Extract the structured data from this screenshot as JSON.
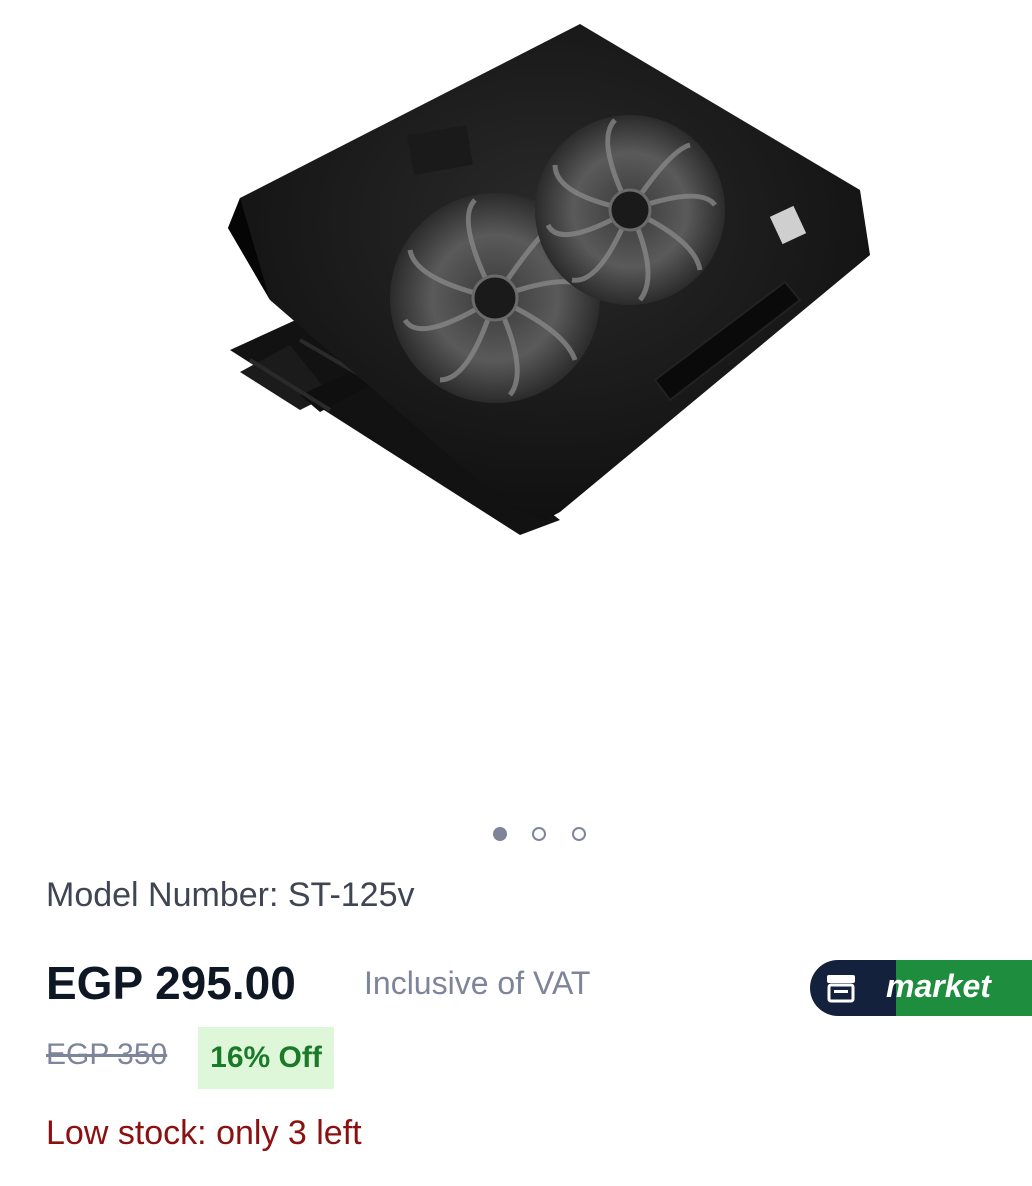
{
  "product": {
    "image_alt": "Laptop cooling pad with two fans",
    "carousel": {
      "count": 3,
      "active_index": 0
    },
    "model_number": "Model Number: ST-125v",
    "price": "EGP 295.00",
    "vat_note": "Inclusive of VAT",
    "old_price": "EGP 350",
    "discount": "16% Off",
    "stock_note": "Low stock: only 3 left"
  },
  "badge": {
    "label": "market",
    "icon": "store-icon"
  },
  "colors": {
    "price": "#0e1724",
    "muted": "#7e859b",
    "discount_bg": "#def7d8",
    "discount_text": "#1a7a2a",
    "stock_warning": "#8b1010",
    "badge_navy": "#14213d",
    "badge_green": "#1e8e3e"
  }
}
